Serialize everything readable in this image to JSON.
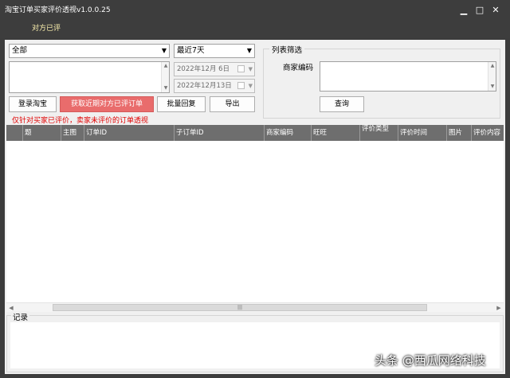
{
  "window": {
    "title": "淘宝订单买家评价透视v1.0.0.25",
    "minimize_glyph": "▁",
    "maximize_glyph": "□",
    "close_glyph": "✕"
  },
  "tab": {
    "label": "对方已评"
  },
  "filters": {
    "scope_select": "全部",
    "period_select": "最近7天",
    "start_date": "2022年12月 6日",
    "end_date": "2022年12月13日"
  },
  "buttons": {
    "login": "登录淘宝",
    "fetch_recent": "获取近期对方已评订单",
    "batch_reply": "批量回复",
    "export": "导出",
    "query": "查询"
  },
  "hint_text": "仅针对买家已评价，卖家未评价的订单透视",
  "list_filter": {
    "title": "列表筛选",
    "merchant_code_label": "商家编码"
  },
  "table": {
    "columns": [
      "",
      "题",
      "主图",
      "订单ID",
      "子订单ID",
      "商家编码",
      "旺旺",
      "评价类型",
      "评价时间",
      "图片",
      "评价内容"
    ]
  },
  "log": {
    "title": "记录"
  },
  "watermark": "头条 @西瓜网络科技",
  "colors": {
    "titlebar": "#3d3d3d",
    "accent_button": "#e96c6c",
    "hint": "#e00000",
    "table_header": "#6e6e6e"
  }
}
